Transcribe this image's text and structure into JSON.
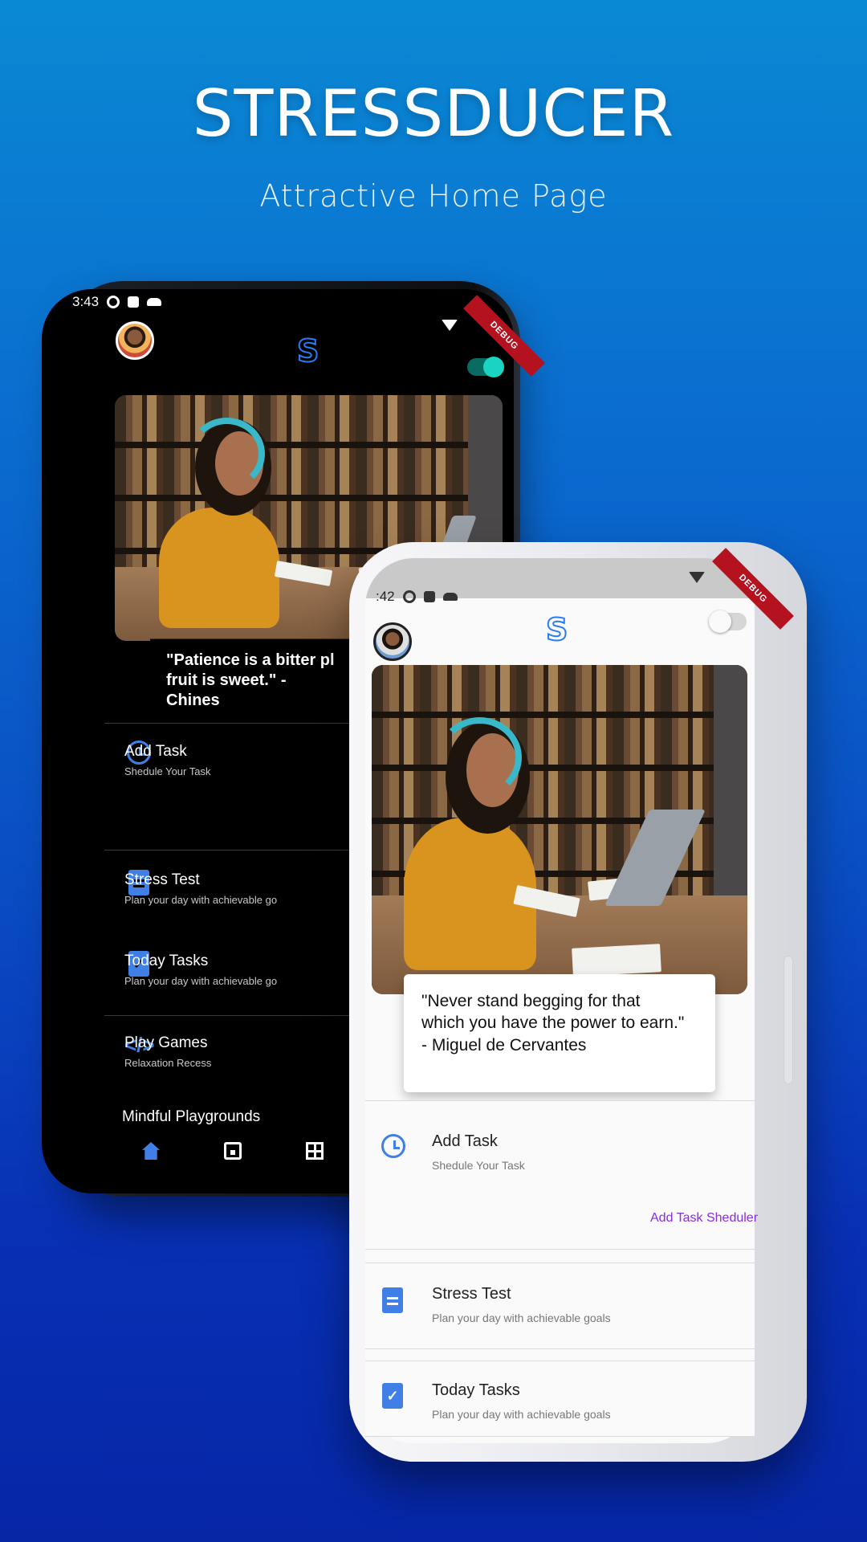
{
  "hero": {
    "title": "STRESSDUCER",
    "subtitle": "Attractive Home Page"
  },
  "dark_phone": {
    "status_time": "3:43",
    "debug_label": "DEBUG",
    "quote": "\"Patience is a bitter pl",
    "quote_line2": "fruit is sweet.\" - Chines",
    "items": [
      {
        "title": "Add Task",
        "subtitle": "Shedule Your Task",
        "icon": "alarm-clock-icon"
      },
      {
        "title": "Stress Test",
        "subtitle": "Plan your day with achievable go",
        "icon": "document-icon"
      },
      {
        "title": "Today Tasks",
        "subtitle": "Plan your day with achievable go",
        "icon": "check-document-icon"
      },
      {
        "title": "Play Games",
        "subtitle": "Relaxation Recess",
        "icon": "code-icon"
      }
    ],
    "section_label": "Mindful Playgrounds",
    "nav": [
      "home-icon",
      "calendar-icon",
      "grid-icon"
    ]
  },
  "light_phone": {
    "status_time": ":42",
    "debug_label": "DEBUG",
    "quote_line1": "\"Never stand begging for that",
    "quote_line2": "which you have the power to earn.\"",
    "quote_line3": "- Miguel de Cervantes",
    "items": [
      {
        "title": "Add Task",
        "subtitle": "Shedule Your Task",
        "icon": "alarm-clock-icon"
      },
      {
        "title": "Stress Test",
        "subtitle": "Plan your day with achievable goals",
        "icon": "document-icon"
      },
      {
        "title": "Today Tasks",
        "subtitle": "Plan your day with achievable goals",
        "icon": "check-document-icon"
      }
    ],
    "add_task_link": "Add Task Sheduler"
  },
  "colors": {
    "accent_blue": "#3f7fe6",
    "toggle_teal": "#1ad3c1",
    "link_purple": "#8a2be2",
    "debug_red": "#b3121e"
  }
}
